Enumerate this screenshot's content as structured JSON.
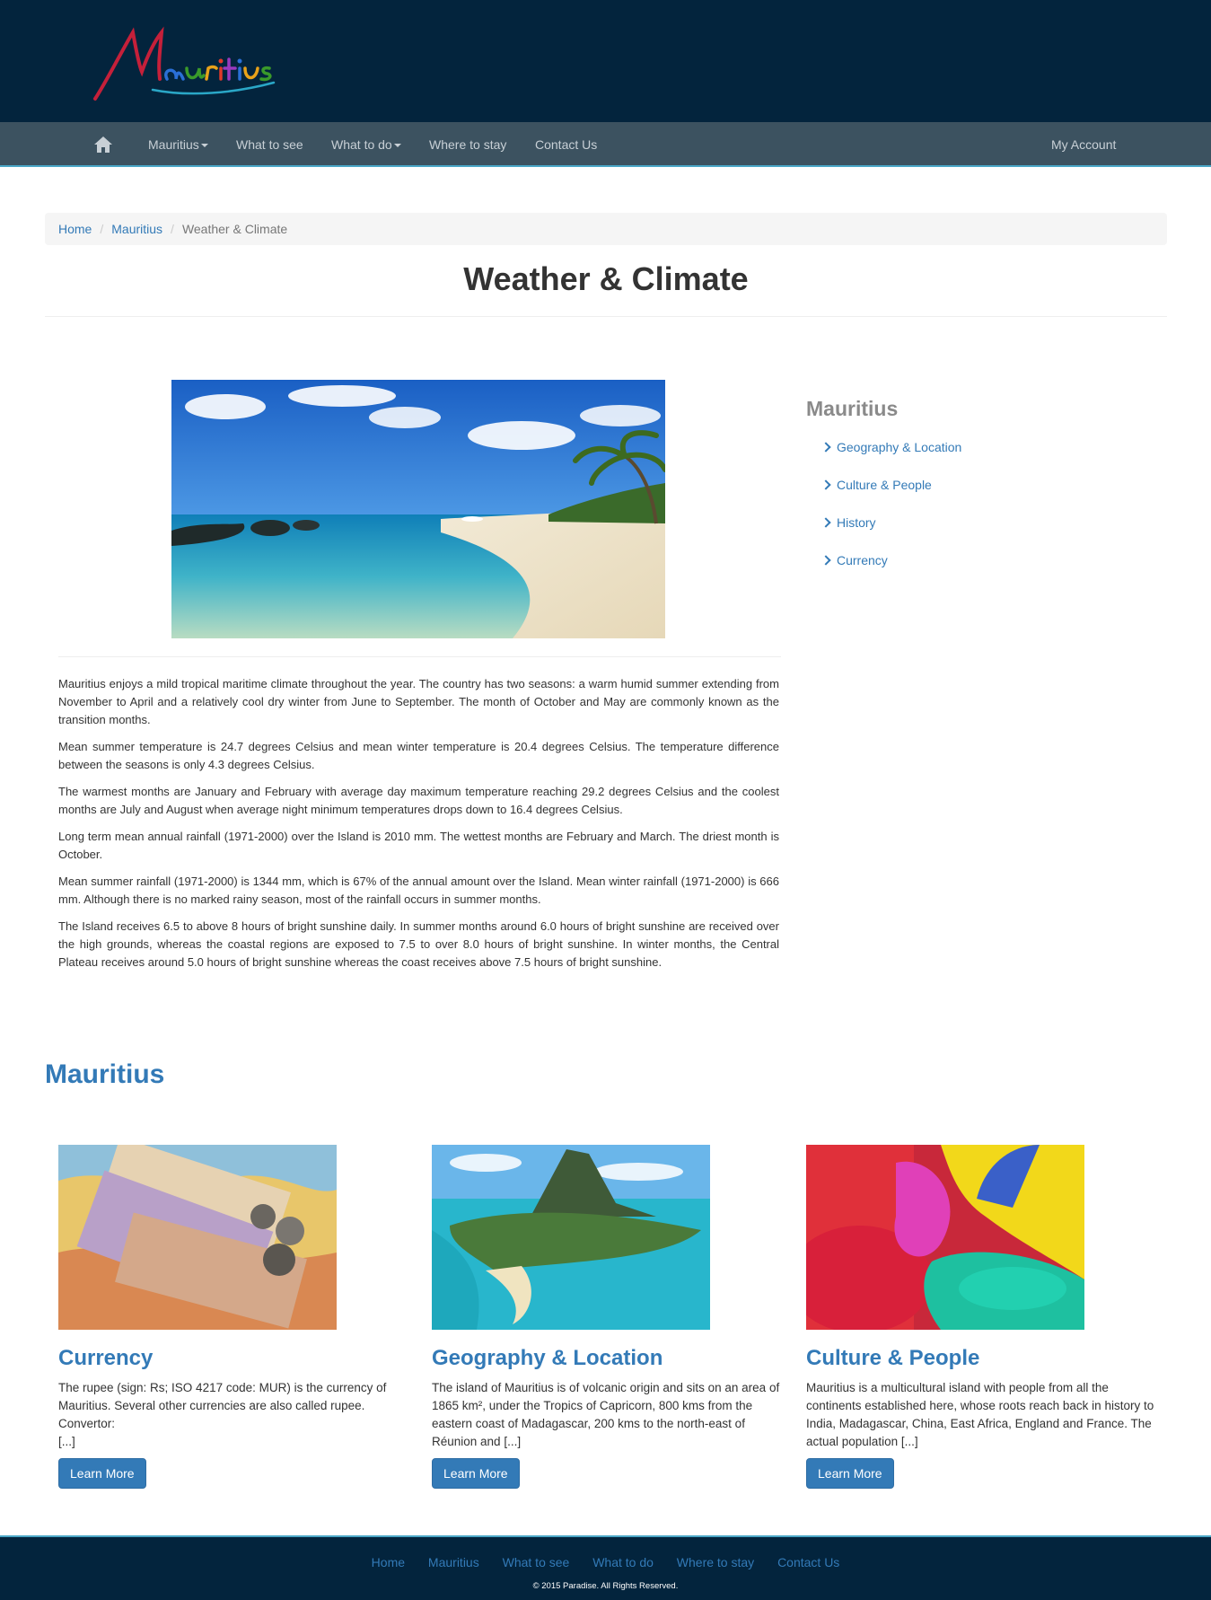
{
  "header": {
    "logo_text": "Mauritius"
  },
  "nav": {
    "items": [
      {
        "label": "Mauritius"
      },
      {
        "label": "What to see"
      },
      {
        "label": "What to do"
      },
      {
        "label": "Where to stay"
      },
      {
        "label": "Contact Us"
      }
    ],
    "account": "My Account",
    "home_icon": "home-icon"
  },
  "breadcrumb": {
    "home": "Home",
    "parent": "Mauritius",
    "current": "Weather & Climate"
  },
  "page": {
    "title": "Weather & Climate"
  },
  "article": {
    "paragraphs": [
      "Mauritius enjoys a mild tropical maritime climate throughout the year. The country has two seasons: a warm humid summer extending from November to April and a relatively cool dry winter from June to September. The month of October and May are commonly known as the transition months.",
      "Mean summer temperature is 24.7 degrees Celsius and mean winter temperature is 20.4 degrees Celsius. The temperature difference between the seasons is only 4.3 degrees Celsius.",
      "The warmest months are January and February with average day maximum temperature reaching 29.2 degrees Celsius and the coolest months are July and August when average night minimum temperatures drops down to 16.4 degrees Celsius.",
      "Long term mean annual rainfall (1971-2000) over the Island is 2010 mm. The wettest months are February and March. The driest month is October.",
      "Mean summer rainfall (1971-2000) is 1344 mm, which is 67% of the annual amount over the Island. Mean winter rainfall (1971-2000) is 666 mm. Although there is no marked rainy season, most of the rainfall occurs in summer months.",
      "The Island receives 6.5 to above 8 hours of bright sunshine daily. In summer months around 6.0 hours of bright sunshine are received over the high grounds, whereas the coastal regions are exposed to 7.5 to over 8.0 hours of bright sunshine. In winter months, the Central Plateau receives around 5.0 hours of bright sunshine whereas the coast receives above 7.5 hours of bright sunshine."
    ]
  },
  "sidebar": {
    "title": "Mauritius",
    "links": [
      {
        "label": "Geography & Location"
      },
      {
        "label": "Culture & People"
      },
      {
        "label": "History"
      },
      {
        "label": "Currency"
      }
    ]
  },
  "section": {
    "title": "Mauritius",
    "cards": [
      {
        "title": "Currency",
        "text": "The rupee (sign: Rs; ISO 4217 code: MUR) is the currency of Mauritius. Several other currencies are also called rupee. Convertor:",
        "ellipsis": "[...]",
        "button": "Learn More"
      },
      {
        "title": "Geography & Location",
        "text": "The island of Mauritius is of volcanic origin and sits on an area of 1865 km², under the Tropics of Capricorn, 800 kms from the eastern coast of Madagascar, 200 kms to the north-east of Réunion and [...]",
        "button": "Learn More"
      },
      {
        "title": "Culture & People",
        "text": "Mauritius is a multicultural island with people from all the continents established here, whose roots reach back in history to India, Madagascar, China, East Africa, England and France. The actual population [...]",
        "button": "Learn More"
      }
    ]
  },
  "footer": {
    "links": [
      {
        "label": "Home"
      },
      {
        "label": "Mauritius"
      },
      {
        "label": "What to see"
      },
      {
        "label": "What to do"
      },
      {
        "label": "Where to stay"
      },
      {
        "label": "Contact Us"
      }
    ],
    "copyright": "© 2015 Paradise. All Rights Reserved."
  },
  "colors": {
    "header_bg": "#03243d",
    "nav_bg": "#3c5260",
    "link": "#337ab7",
    "accent_line": "#4aa7c7"
  }
}
